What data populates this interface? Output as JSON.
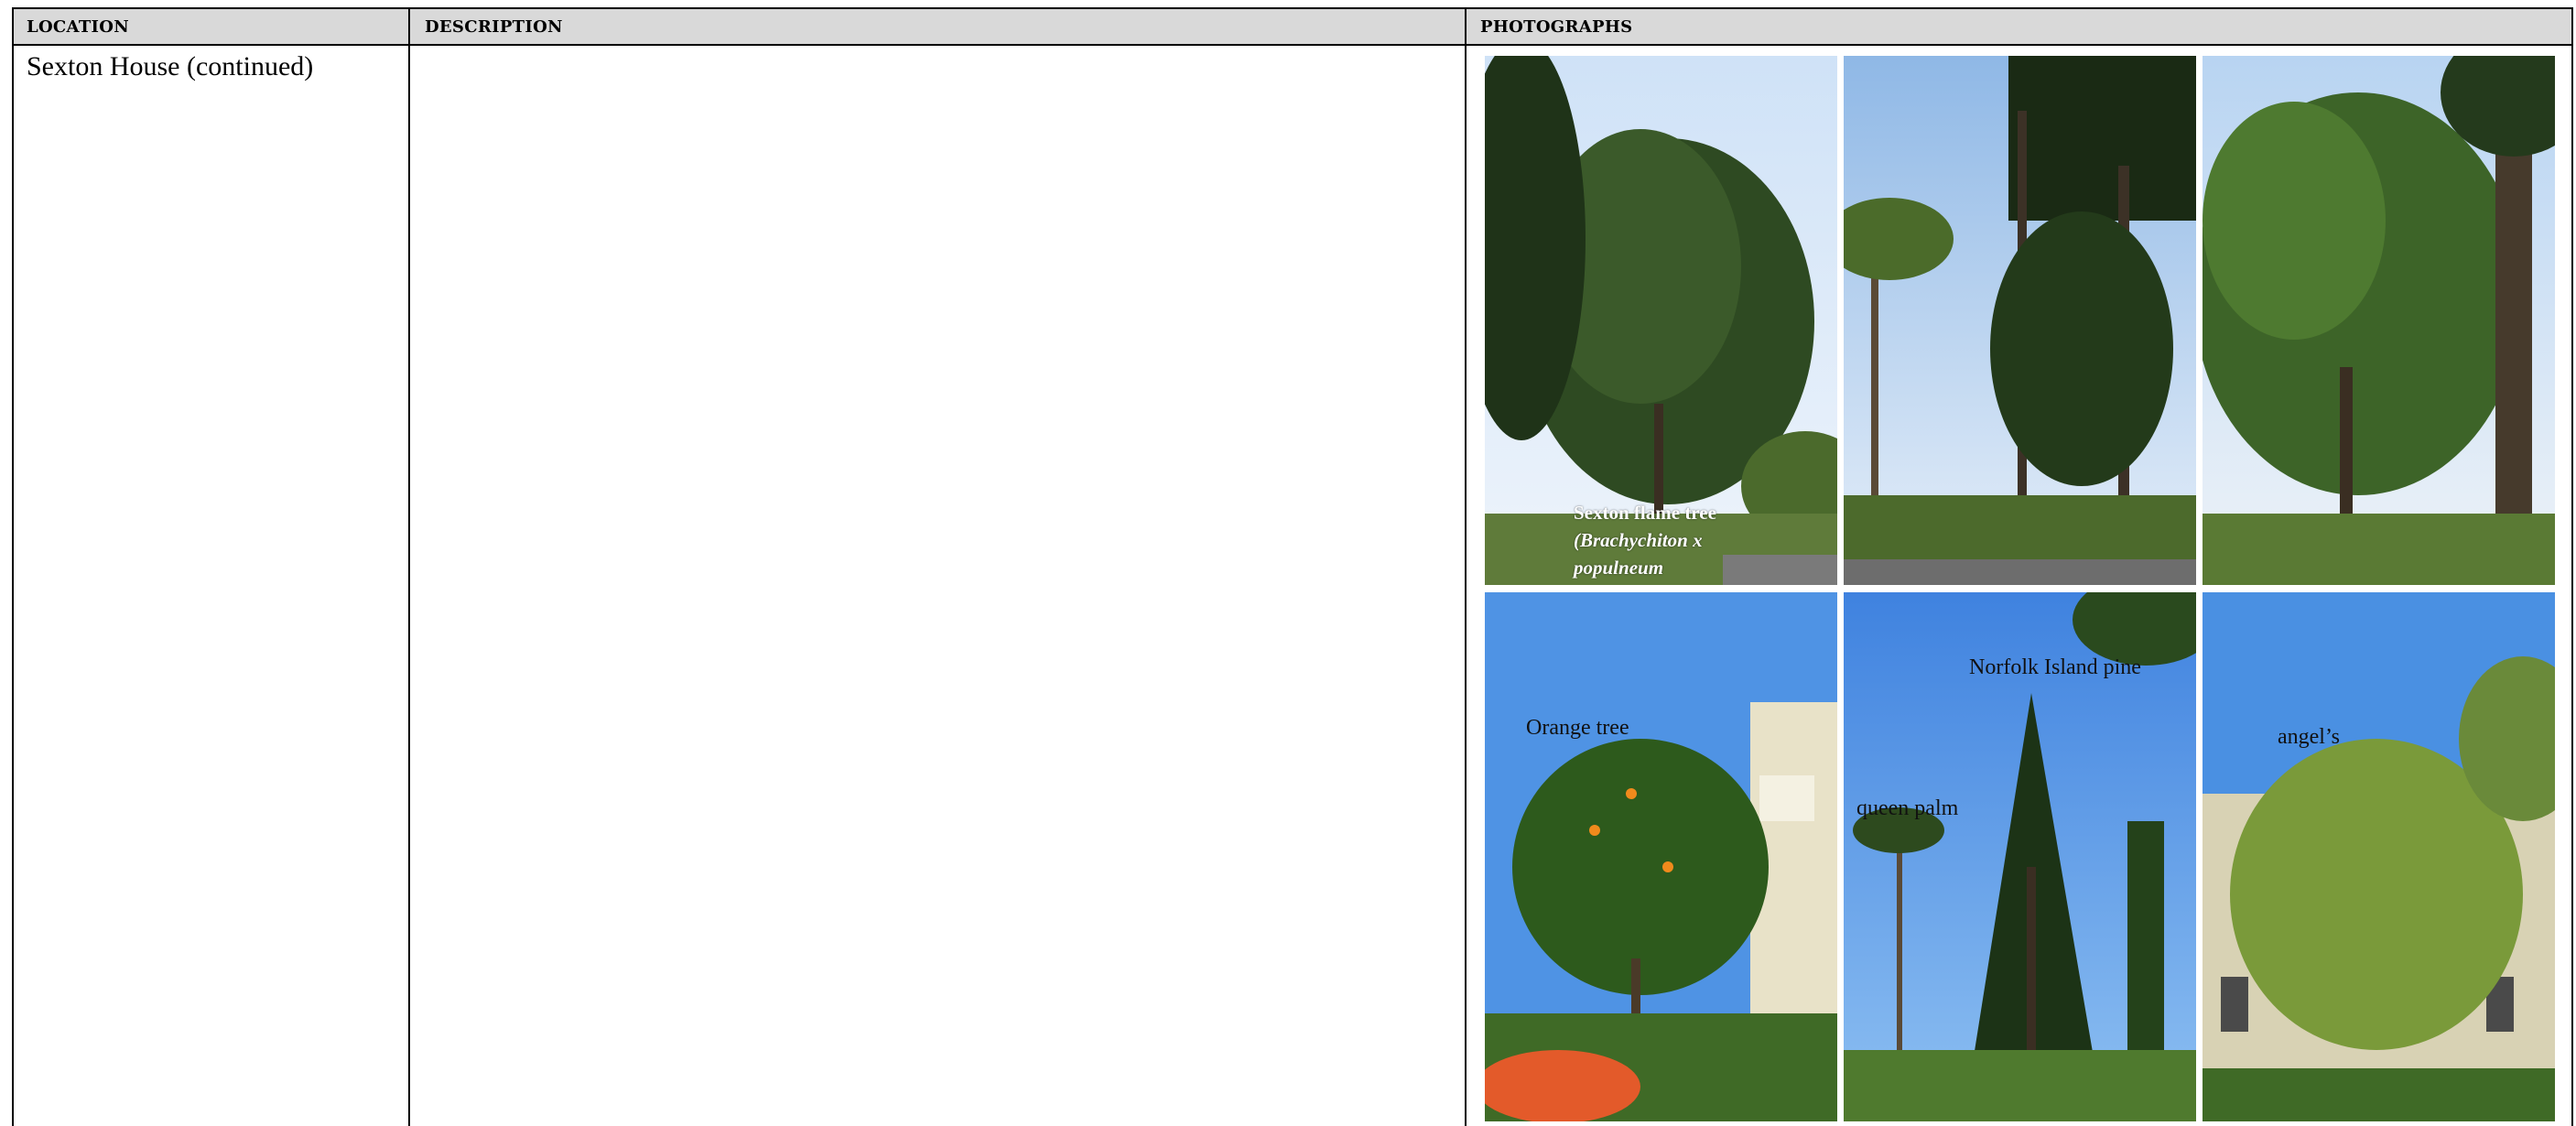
{
  "table": {
    "headers": {
      "location": "LOCATION",
      "description": "DESCRIPTION",
      "photographs": "PHOTOGRAPHS"
    },
    "location_cell": "Sexton House (continued)",
    "description_cell": ""
  },
  "photos": [
    {
      "caption_line1": "Sexton flame tree",
      "caption_line2": "(Brachychiton x",
      "caption_line3": "populneum"
    },
    {
      "caption": ""
    },
    {
      "caption": ""
    },
    {
      "caption": "Orange tree"
    },
    {
      "captions": [
        "Norfolk Island pine",
        "queen palm"
      ]
    },
    {
      "caption": "angel’s"
    }
  ],
  "colors": {
    "header_bg": "#d9d9d9",
    "sky": "#5a9be8",
    "foliage": "#2f5a1f"
  }
}
